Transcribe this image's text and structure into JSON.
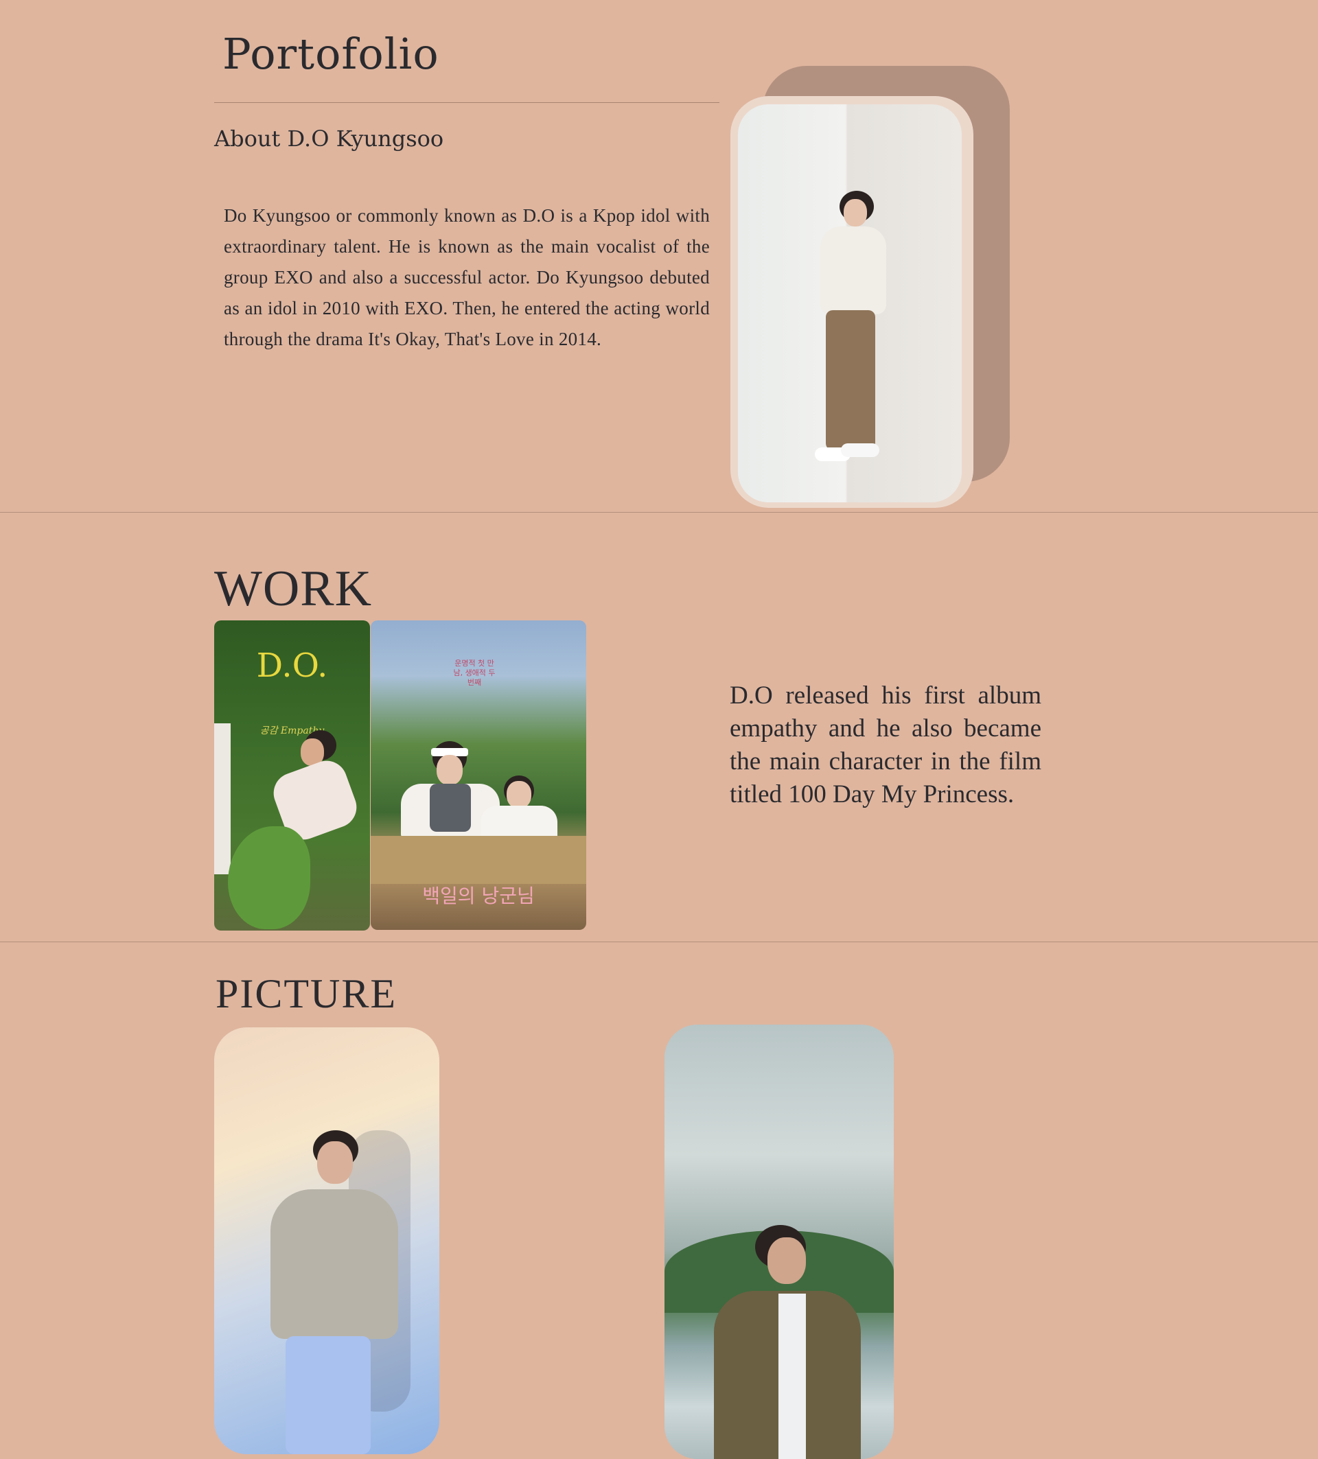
{
  "header": {
    "title": "Portofolio",
    "subtitle": "About D.O Kyungsoo"
  },
  "about": {
    "text": "Do Kyungsoo or commonly known as D.O is a Kpop idol with extraordinary talent. He is known as the main vocalist of the group EXO and also a successful actor. Do Kyungsoo debuted as an idol in 2010 with EXO. Then, he entered the acting world through the drama It's Okay, That's Love in 2014."
  },
  "work": {
    "heading": "WORK",
    "album_poster": {
      "title": "D.O.",
      "subtitle": "공감 Empathy"
    },
    "film_poster": {
      "title": "백일의 낭군님",
      "tagline": "운명적 첫 만남, 생애적 두 번째"
    },
    "text": "D.O released his first album empathy and he also became the main character in the film titled 100 Day My Princess."
  },
  "picture": {
    "heading": "PICTURE"
  },
  "colors": {
    "background": "#dfb59e",
    "frame_back": "#b39180",
    "frame_mid": "#ecd8cb",
    "text": "#2a2a2e"
  }
}
